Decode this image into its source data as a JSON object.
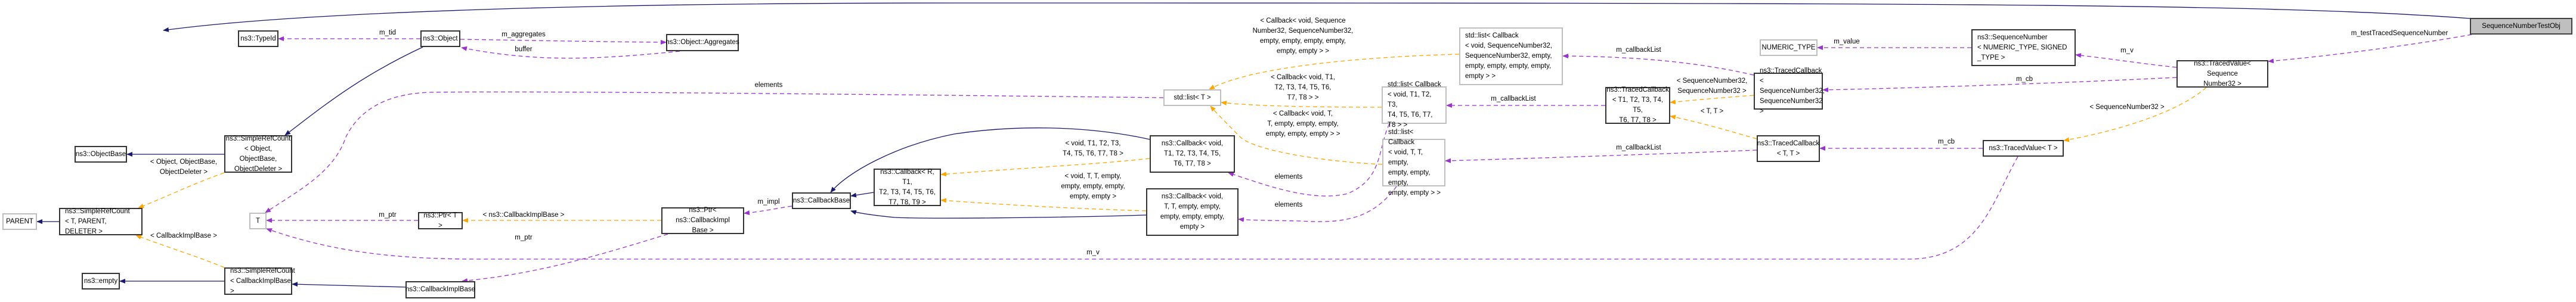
{
  "colors": {
    "inheritance": "#191970",
    "member": "#9a32cd",
    "template": "#ffa500",
    "focus_fill": "#bfbfbf"
  },
  "nodes": {
    "typeid": "ns3::TypeId",
    "object": "ns3::Object",
    "aggregates": "ns3::Object::Aggregates",
    "objectbase": "ns3::ObjectBase",
    "src_object": "ns3::SimpleRefCount\n< Object, ObjectBase,\nObjectDeleter >",
    "parent": "PARENT",
    "src_generic": "ns3::SimpleRefCount\n< T, PARENT, DELETER >",
    "empty": "ns3::empty",
    "src_cbimpl": "ns3::SimpleRefCount\n< CallbackImplBase >",
    "t": "T",
    "ptr_t": "ns3::Ptr< T >",
    "ptr_cbimpl": "ns3::Ptr< ns3::CallbackImpl\nBase >",
    "cbimplbase": "ns3::CallbackImplBase",
    "callbackbase": "ns3::CallbackBase",
    "callback_generic": "ns3::Callback< R, T1,\nT2, T3, T4, T5, T6,\nT7, T8, T9 >",
    "callback_t1t8": "ns3::Callback< void,\nT1, T2, T3, T4, T5,\nT6, T7, T8 >",
    "callback_tt": "ns3::Callback< void,\nT, T, empty, empty,\nempty, empty, empty,\nempty >",
    "list_t": "std::list< T >",
    "list_t1t8": "std::list< Callback\n< void, T1, T2, T3,\nT4, T5, T6, T7, T8 > >",
    "list_tt": "std::list< Callback\n< void, T, T, empty,\nempty, empty, empty,\nempty, empty > >",
    "list_seq": "std::list< Callback\n< void, SequenceNumber32,\nSequenceNumber32, empty,\nempty, empty, empty, empty,\nempty > >",
    "tc_t1t8": "ns3::TracedCallback\n< T1, T2, T3, T4, T5,\nT6, T7, T8 >",
    "tc_seq": "ns3::TracedCallback\n< SequenceNumber32,\nSequenceNumber32 >",
    "tc_tt": "ns3::TracedCallback\n< T, T >",
    "numeric_type": "NUMERIC_TYPE",
    "seqnum": "ns3::SequenceNumber\n< NUMERIC_TYPE, SIGNED\n_TYPE >",
    "tv_seq": "ns3::TracedValue< Sequence\nNumber32 >",
    "tv_t": "ns3::TracedValue< T >",
    "test_obj": "SequenceNumberTestObj"
  },
  "edge_labels": {
    "m_tid": "m_tid",
    "m_aggregates": "m_aggregates",
    "buffer": "buffer",
    "src_object_tpl": "< Object, ObjectBase,\nObjectDeleter >",
    "src_cbimpl_tpl": "< CallbackImplBase >",
    "elements_list_t": "elements",
    "m_ptr_t": "m_ptr",
    "ptr_tpl": "< ns3::CallbackImplBase >",
    "m_ptr_cbimpl": "m_ptr",
    "m_impl": "m_impl",
    "cb_t1t8_tpl": "< void, T1, T2, T3,\nT4, T5, T6, T7, T8 >",
    "cb_tt_tpl": "< void, T, T, empty,\nempty, empty, empty,\nempty, empty >",
    "list_seq_tpl": "< Callback< void, Sequence\nNumber32, SequenceNumber32,\nempty, empty, empty, empty,\nempty, empty > >",
    "list_t1t8_tpl": "< Callback< void, T1,\nT2, T3, T4, T5, T6,\nT7, T8 > >",
    "list_tt_tpl": "< Callback< void, T,\nT, empty, empty, empty,\nempty, empty, empty > >",
    "elements_t1t8": "elements",
    "elements_tt": "elements",
    "m_callbackList_seq": "m_callbackList",
    "m_callbackList_t1t8": "m_callbackList",
    "m_callbackList_tt": "m_callbackList",
    "tc_seq_tpl": "< SequenceNumber32,\nSequenceNumber32 >",
    "tc_tt_tpl": "< T, T >",
    "m_value": "m_value",
    "m_v_seq": "m_v",
    "m_cb_seq": "m_cb",
    "m_cb_t": "m_cb",
    "tv_tpl": "< SequenceNumber32 >",
    "m_v_t": "m_v",
    "m_testTracedSequenceNumber": "m_testTracedSequenceNumber"
  }
}
